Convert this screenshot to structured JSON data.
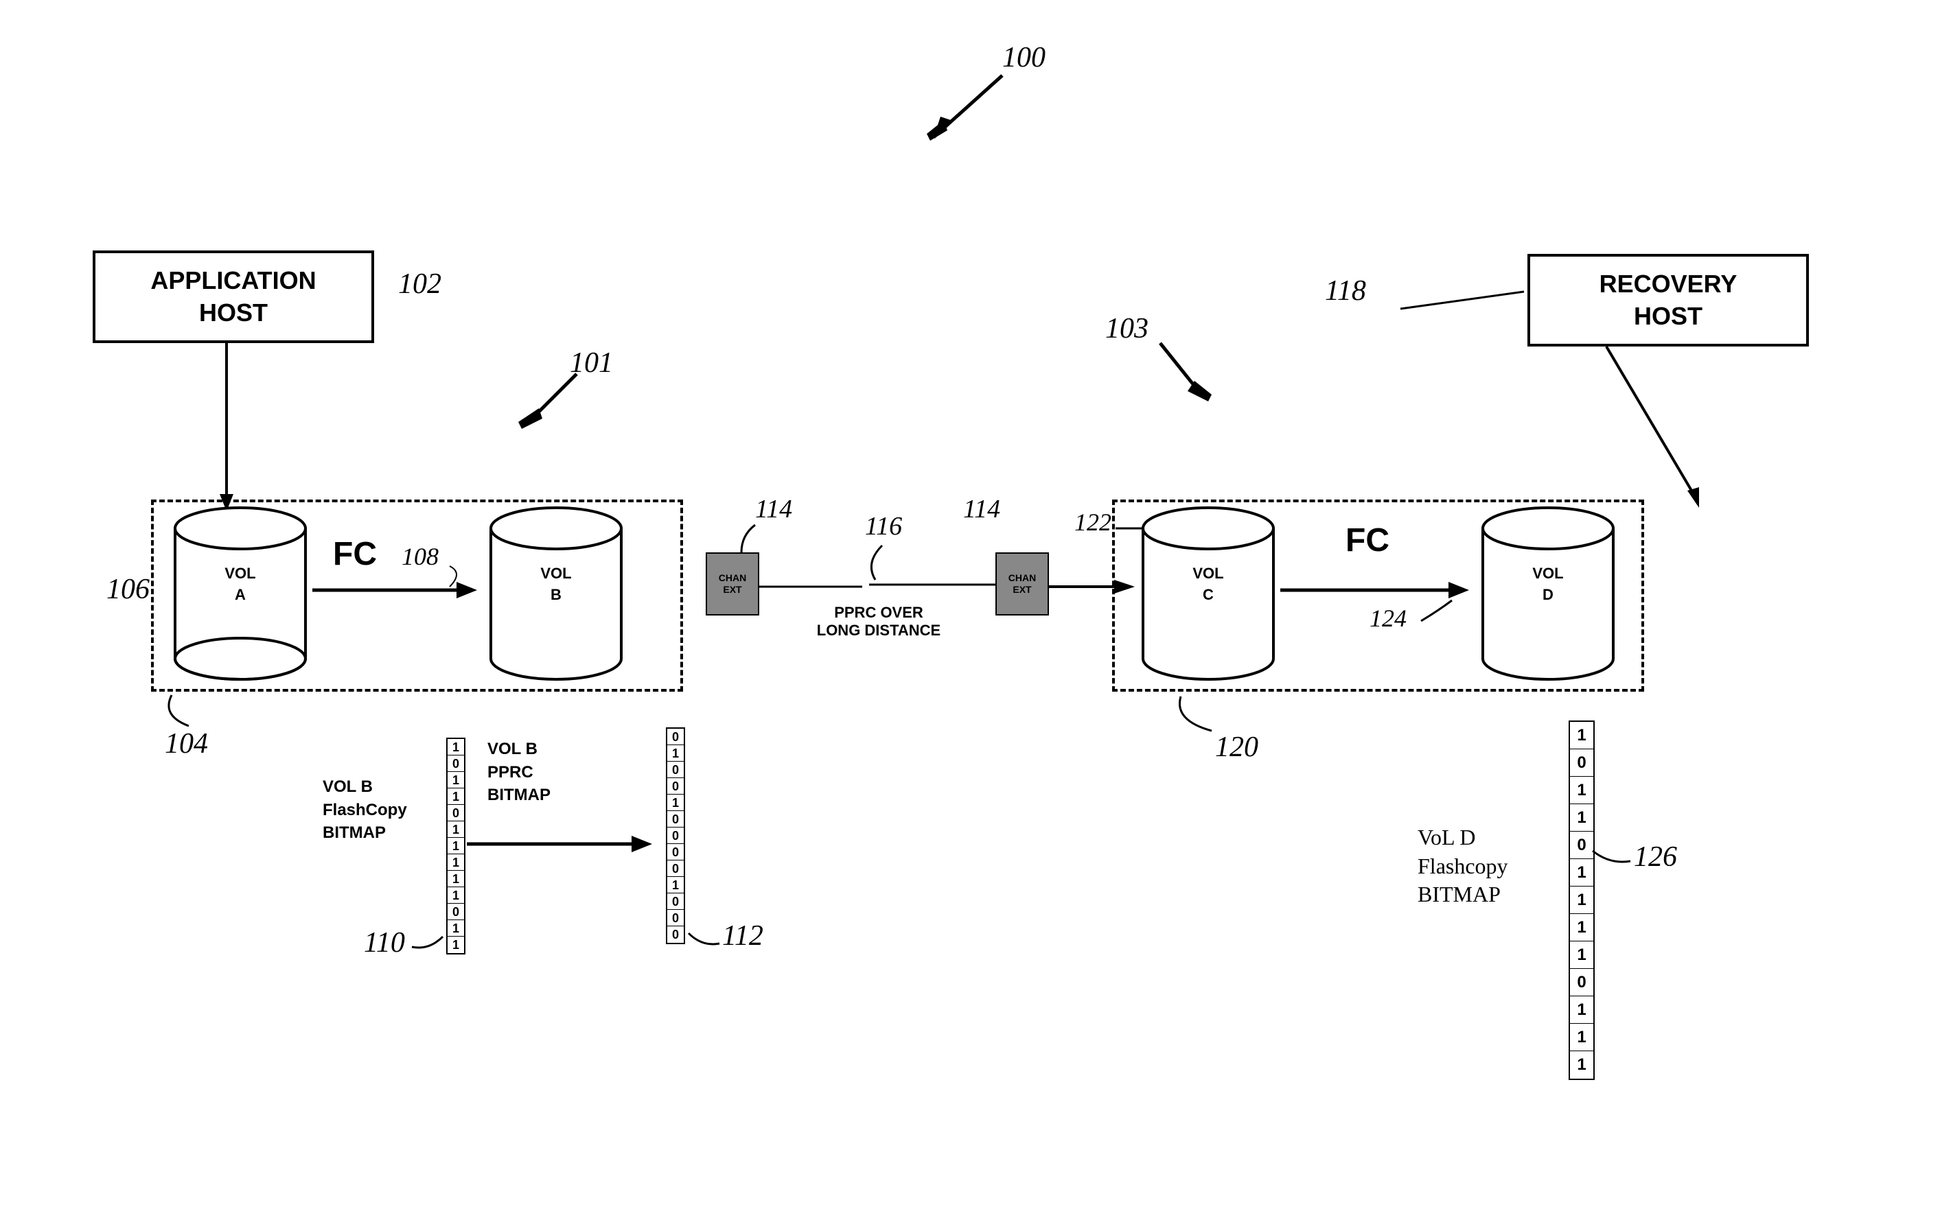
{
  "refs": {
    "system": "100",
    "left_group": "101",
    "app_host": "102",
    "right_group": "103",
    "left_dashed": "104",
    "vol_a": "106",
    "vol_b_arrow": "108",
    "bitmap_fc": "110",
    "bitmap_pprc": "112",
    "chan_ext_left": "114",
    "chan_ext_right": "114",
    "pprc_line": "116",
    "recovery_host": "118",
    "right_dashed": "120",
    "vol_c": "122",
    "vol_d_arrow": "124",
    "bitmap_d": "126"
  },
  "hosts": {
    "application": "APPLICATION\nHOST",
    "recovery": "RECOVERY\nHOST"
  },
  "volumes": {
    "a": {
      "line1": "VOL",
      "line2": "A"
    },
    "b": {
      "line1": "VOL",
      "line2": "B"
    },
    "c": {
      "line1": "VOL",
      "line2": "C"
    },
    "d": {
      "line1": "VOL",
      "line2": "D"
    }
  },
  "labels": {
    "fc": "FC",
    "chan_ext": "CHAN\nEXT",
    "pprc_line": "PPRC OVER\nLONG DISTANCE",
    "bitmap_fc": "VOL B\nFlashCopy\nBITMAP",
    "bitmap_pprc": "VOL B\nPPRC\nBITMAP",
    "bitmap_d": "VoL D\nFlashcopy\nBITMAP"
  },
  "bitmaps": {
    "fc": [
      "1",
      "0",
      "1",
      "1",
      "0",
      "1",
      "1",
      "1",
      "1",
      "1",
      "0",
      "1",
      "1"
    ],
    "pprc": [
      "0",
      "1",
      "0",
      "0",
      "1",
      "0",
      "0",
      "0",
      "0",
      "1",
      "0",
      "0",
      "0"
    ],
    "d": [
      "1",
      "0",
      "1",
      "1",
      "0",
      "1",
      "1",
      "1",
      "1",
      "0",
      "1",
      "1",
      "1"
    ]
  }
}
